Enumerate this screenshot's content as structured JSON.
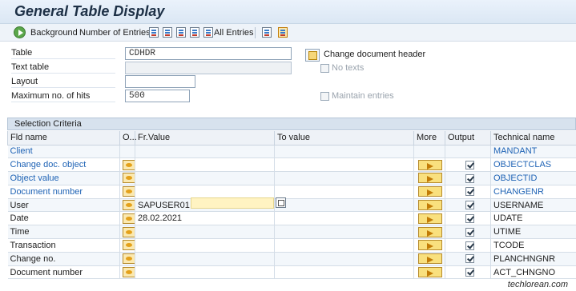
{
  "window": {
    "title": "General Table Display"
  },
  "toolbar": {
    "background_label": "Background",
    "number_of_entries_label": "Number of Entries",
    "all_entries_label": "All Entries"
  },
  "form": {
    "table_label": "Table",
    "table_value": "CDHDR",
    "text_table_label": "Text table",
    "text_table_value": "",
    "layout_label": "Layout",
    "layout_value": "",
    "max_hits_label": "Maximum no. of hits",
    "max_hits_value": "500",
    "change_doc_header_label": "Change document header",
    "no_texts_label": "No texts",
    "maintain_entries_label": "Maintain entries"
  },
  "selection": {
    "section_title": "Selection Criteria",
    "columns": {
      "fld_name": "Fld name",
      "option": "O...",
      "fr_value": "Fr.Value",
      "to_value": "To value",
      "more": "More",
      "output": "Output",
      "technical_name": "Technical name"
    },
    "rows": [
      {
        "fld_name": "Client",
        "fr_value": "",
        "to_value": "",
        "technical_name": "MANDANT"
      },
      {
        "fld_name": "Change doc. object",
        "fr_value": "",
        "to_value": "",
        "technical_name": "OBJECTCLAS"
      },
      {
        "fld_name": "Object value",
        "fr_value": "",
        "to_value": "",
        "technical_name": "OBJECTID"
      },
      {
        "fld_name": "Document number",
        "fr_value": "",
        "to_value": "",
        "technical_name": "CHANGENR"
      },
      {
        "fld_name": "User",
        "fr_value": "SAPUSER01",
        "to_value": "",
        "technical_name": "USERNAME"
      },
      {
        "fld_name": "Date",
        "fr_value": "28.02.2021",
        "to_value": "",
        "technical_name": "UDATE"
      },
      {
        "fld_name": "Time",
        "fr_value": "",
        "to_value": "",
        "technical_name": "UTIME"
      },
      {
        "fld_name": "Transaction",
        "fr_value": "",
        "to_value": "",
        "technical_name": "TCODE"
      },
      {
        "fld_name": "Change no.",
        "fr_value": "",
        "to_value": "",
        "technical_name": "PLANCHNGNR"
      },
      {
        "fld_name": "Document number",
        "fr_value": "",
        "to_value": "",
        "technical_name": "ACT_CHNGNO"
      }
    ]
  },
  "watermark": "techlorean.com",
  "colors": {
    "key_field_text": "#1f63b5",
    "header_bg": "#d7e2ee"
  }
}
